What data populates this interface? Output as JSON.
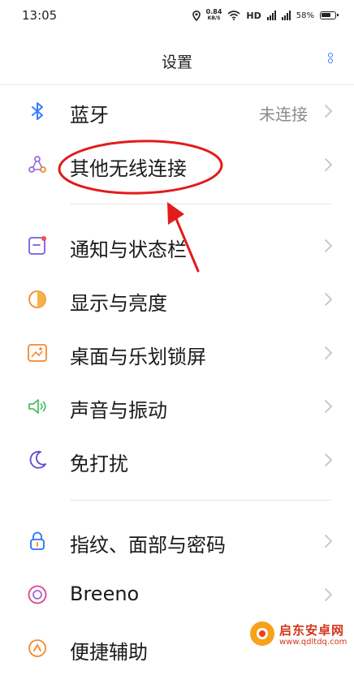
{
  "status_bar": {
    "time": "13:05",
    "net_speed_value": "0.84",
    "net_speed_unit": "KB/S",
    "hd_label": "HD",
    "battery": "58%"
  },
  "header": {
    "title": "设置"
  },
  "sections": [
    {
      "items": [
        {
          "label": "蓝牙",
          "value": "未连接",
          "icon": "bluetooth-icon"
        },
        {
          "label": "其他无线连接",
          "icon": "wireless-connection-icon"
        }
      ]
    },
    {
      "items": [
        {
          "label": "通知与状态栏",
          "icon": "notification-icon"
        },
        {
          "label": "显示与亮度",
          "icon": "brightness-icon"
        },
        {
          "label": "桌面与乐划锁屏",
          "icon": "wallpaper-icon"
        },
        {
          "label": "声音与振动",
          "icon": "speaker-icon"
        },
        {
          "label": "免打扰",
          "icon": "moon-icon"
        }
      ]
    },
    {
      "items": [
        {
          "label": "指纹、面部与密码",
          "icon": "lock-icon"
        },
        {
          "label": "Breeno",
          "icon": "breeno-icon"
        },
        {
          "label": "便捷辅助",
          "icon": "assist-icon"
        }
      ]
    }
  ],
  "watermark": {
    "title": "启东安卓网",
    "url": "www.qdltdq.com"
  },
  "colors": {
    "accent": "#3a7bfd",
    "annotation": "#e31b1b",
    "secondary_text": "#8a8a8a"
  }
}
